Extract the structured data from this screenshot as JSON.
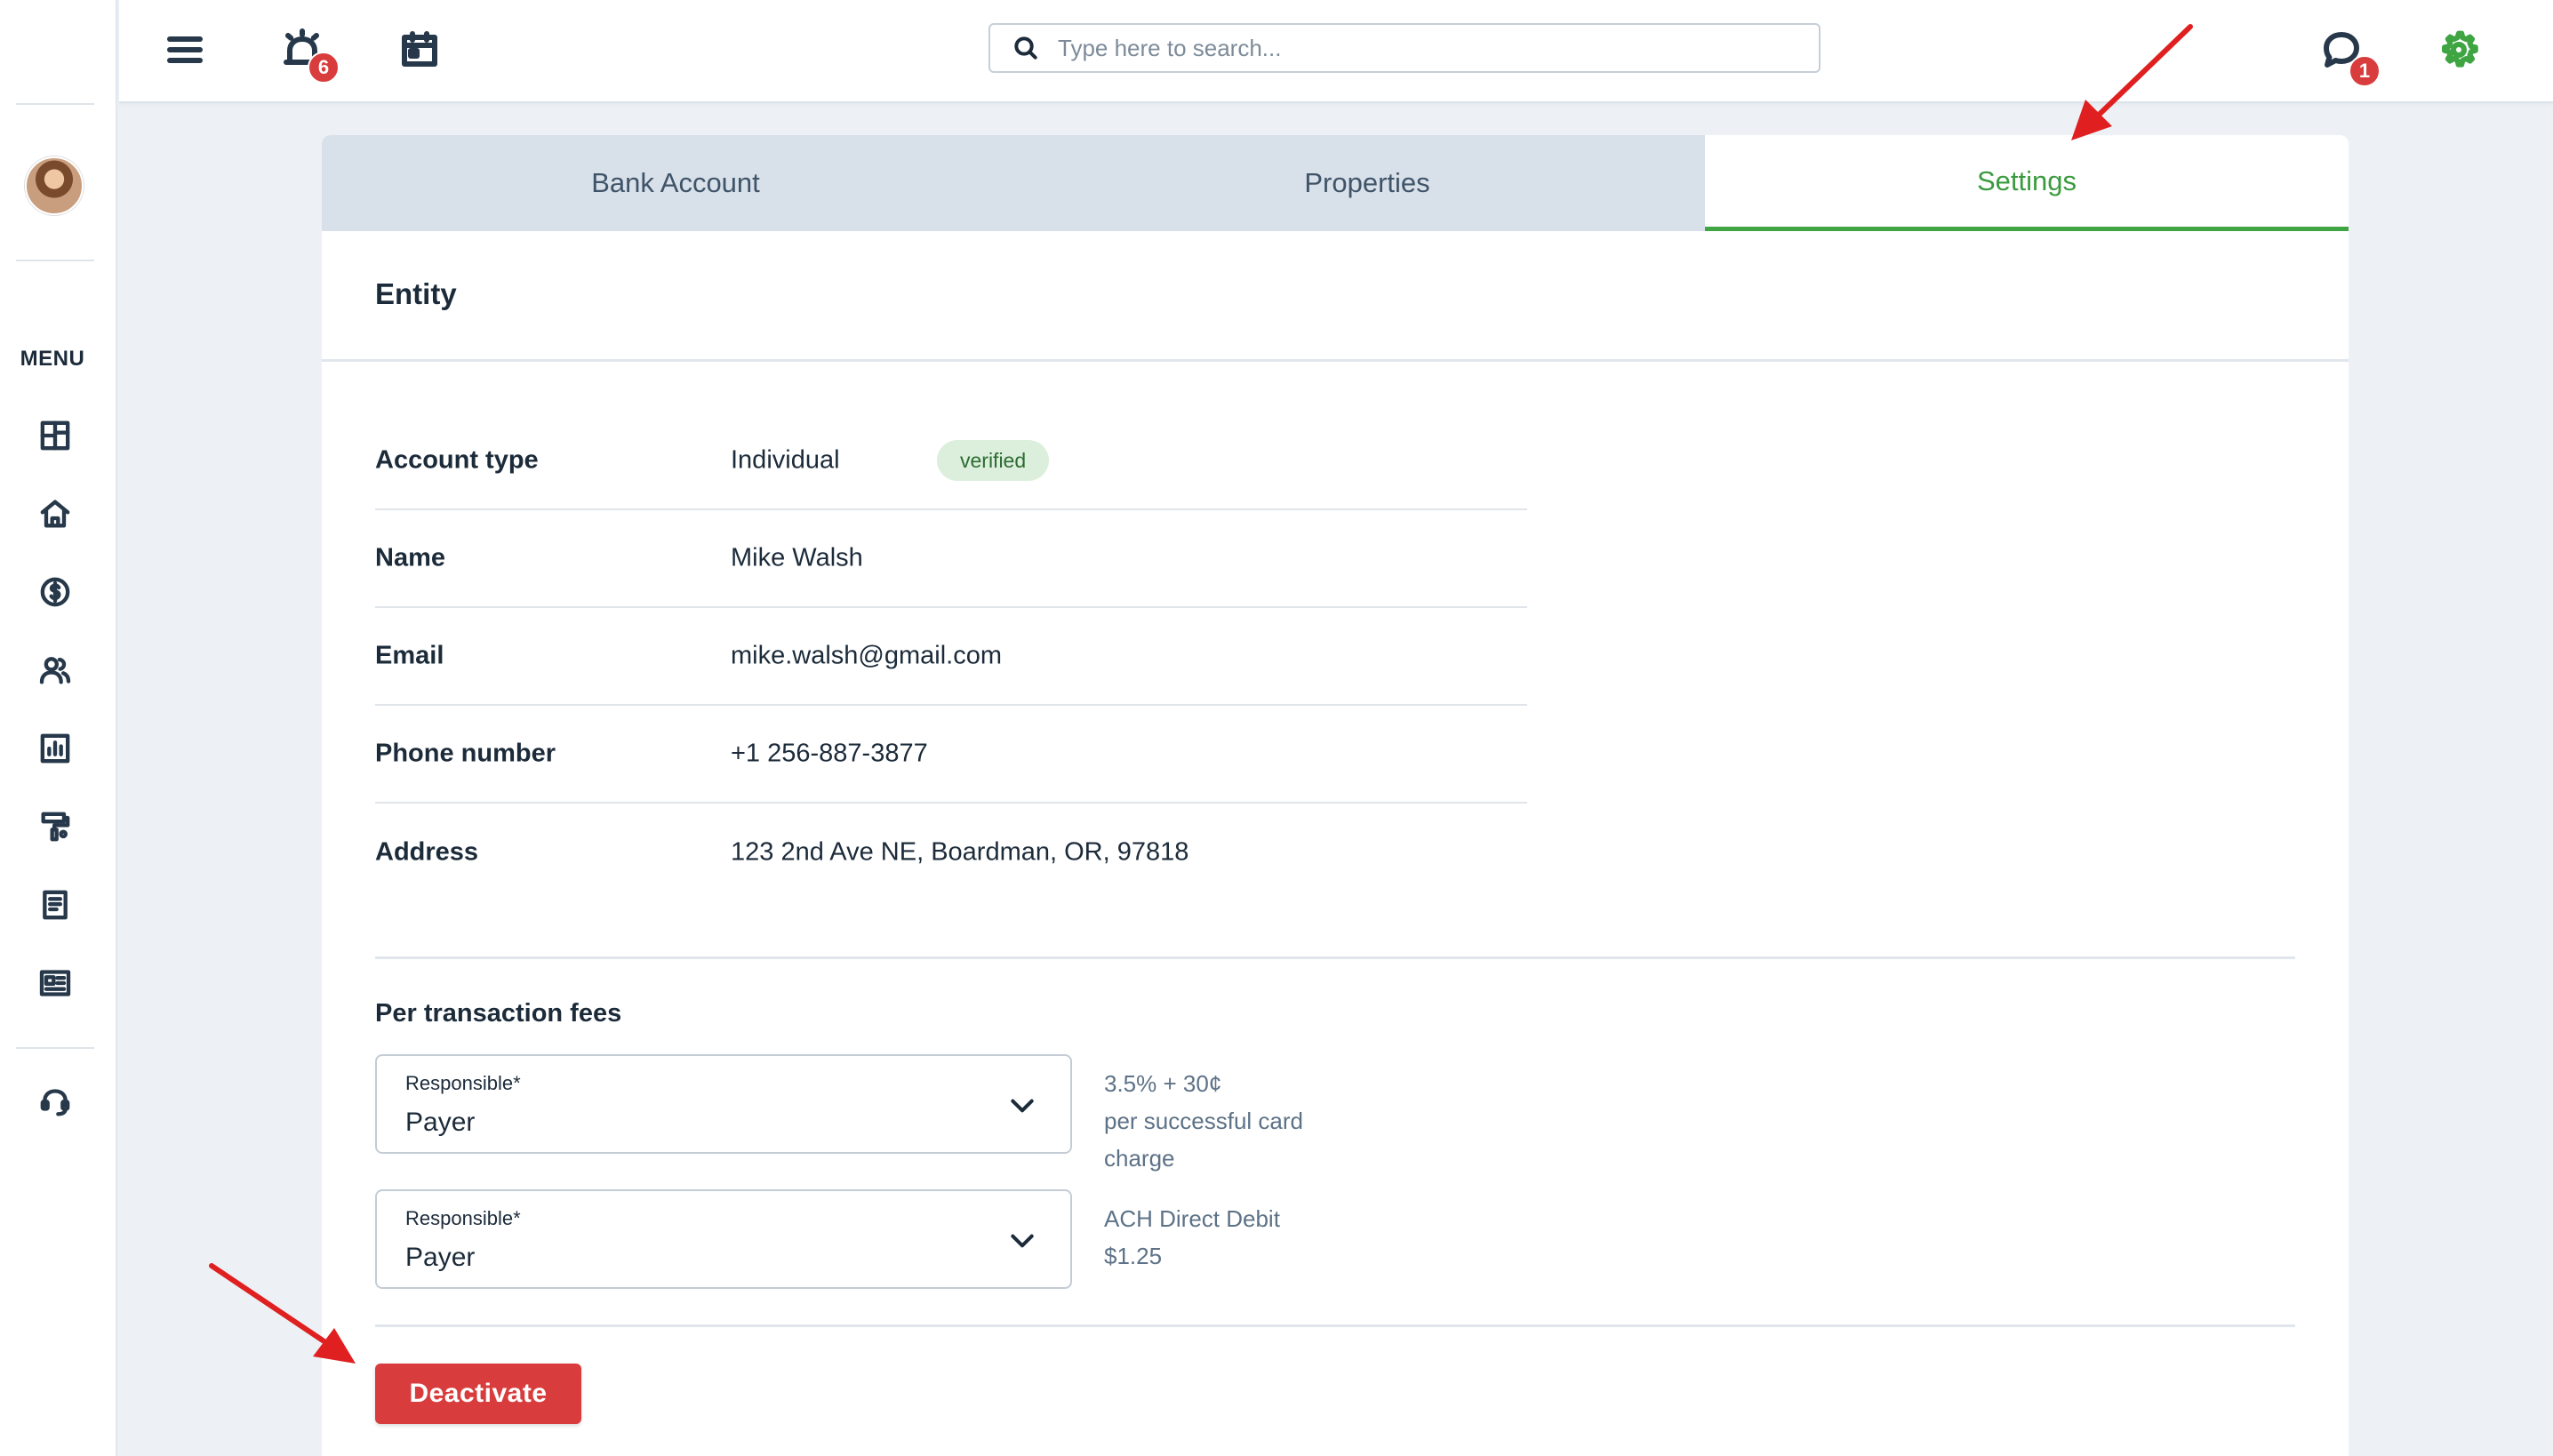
{
  "sidebar": {
    "menu_label": "MENU",
    "items": [
      {
        "icon": "dashboard-icon"
      },
      {
        "icon": "home-icon"
      },
      {
        "icon": "dollar-icon"
      },
      {
        "icon": "users-icon"
      },
      {
        "icon": "reports-icon"
      },
      {
        "icon": "maintenance-icon"
      },
      {
        "icon": "document-icon"
      },
      {
        "icon": "listing-icon"
      }
    ],
    "support_icon": "headset-icon"
  },
  "topbar": {
    "alerts_count": "6",
    "search_placeholder": "Type here to search...",
    "messages_count": "1"
  },
  "tabs": [
    {
      "label": "Bank Account",
      "active": false
    },
    {
      "label": "Properties",
      "active": false
    },
    {
      "label": "Settings",
      "active": true
    }
  ],
  "entity": {
    "title": "Entity",
    "account_type_label": "Account type",
    "account_type_value": "Individual",
    "verified_badge": "verified",
    "name_label": "Name",
    "name_value": "Mike Walsh",
    "email_label": "Email",
    "email_value": "mike.walsh@gmail.com",
    "phone_label": "Phone number",
    "phone_value": "+1 256-887-3877",
    "address_label": "Address",
    "address_value": "123 2nd Ave NE, Boardman, OR, 97818"
  },
  "fees": {
    "title": "Per transaction fees",
    "card": {
      "select_label": "Responsible*",
      "select_value": "Payer",
      "note_line1": "3.5% + 30¢",
      "note_line2": "per successful card",
      "note_line3": "charge"
    },
    "ach": {
      "select_label": "Responsible*",
      "select_value": "Payer",
      "note_line1": "ACH Direct Debit",
      "note_line2": "$1.25"
    }
  },
  "actions": {
    "deactivate_label": "Deactivate"
  },
  "colors": {
    "accent_green": "#3ea542",
    "danger_red": "#d93c3c",
    "annotation_arrow": "#e02020"
  }
}
